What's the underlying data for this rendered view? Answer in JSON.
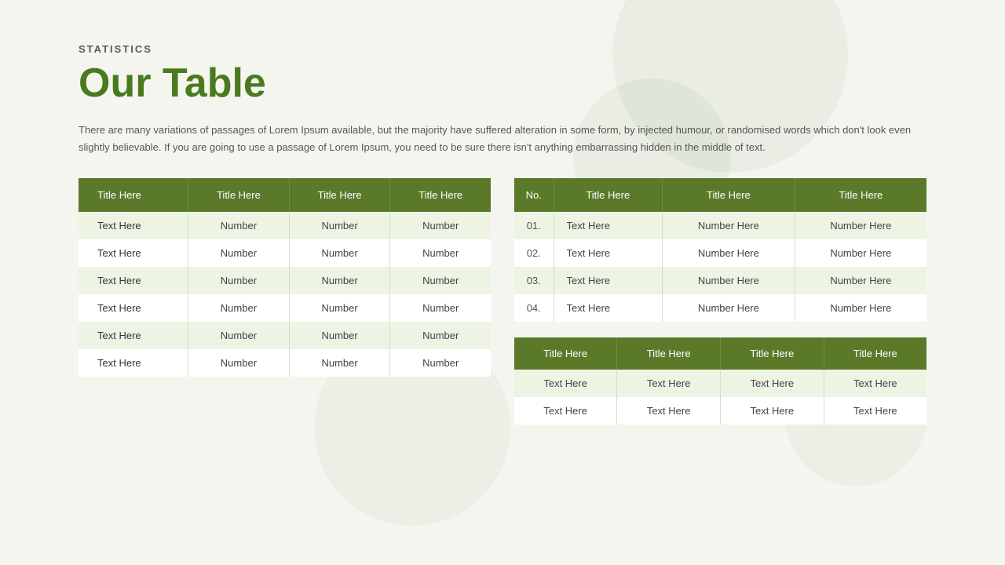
{
  "page": {
    "section_label": "STATISTICS",
    "title": "Our Table",
    "description": "There are many variations of passages of Lorem Ipsum available, but the majority have suffered alteration in some form, by injected humour, or randomised words which don't look even slightly believable. If you are going to use a passage of Lorem Ipsum, you need to be sure there isn't anything embarrassing hidden in the middle of text."
  },
  "left_table": {
    "headers": [
      "Title Here",
      "Title Here",
      "Title Here",
      "Title Here"
    ],
    "rows": [
      [
        "Text Here",
        "Number",
        "Number",
        "Number"
      ],
      [
        "Text Here",
        "Number",
        "Number",
        "Number"
      ],
      [
        "Text Here",
        "Number",
        "Number",
        "Number"
      ],
      [
        "Text Here",
        "Number",
        "Number",
        "Number"
      ],
      [
        "Text Here",
        "Number",
        "Number",
        "Number"
      ],
      [
        "Text Here",
        "Number",
        "Number",
        "Number"
      ]
    ]
  },
  "right_top_table": {
    "headers": [
      "No.",
      "Title Here",
      "Title Here",
      "Title Here"
    ],
    "rows": [
      [
        "01.",
        "Text Here",
        "Number Here",
        "Number Here"
      ],
      [
        "02.",
        "Text Here",
        "Number Here",
        "Number Here"
      ],
      [
        "03.",
        "Text Here",
        "Number Here",
        "Number Here"
      ],
      [
        "04.",
        "Text Here",
        "Number Here",
        "Number Here"
      ]
    ]
  },
  "right_bottom_table": {
    "headers": [
      "Title Here",
      "Title Here",
      "Title Here",
      "Title Here"
    ],
    "rows": [
      [
        "Text Here",
        "Text Here",
        "Text Here",
        "Text Here"
      ],
      [
        "Text Here",
        "Text Here",
        "Text Here",
        "Text Here"
      ]
    ]
  }
}
